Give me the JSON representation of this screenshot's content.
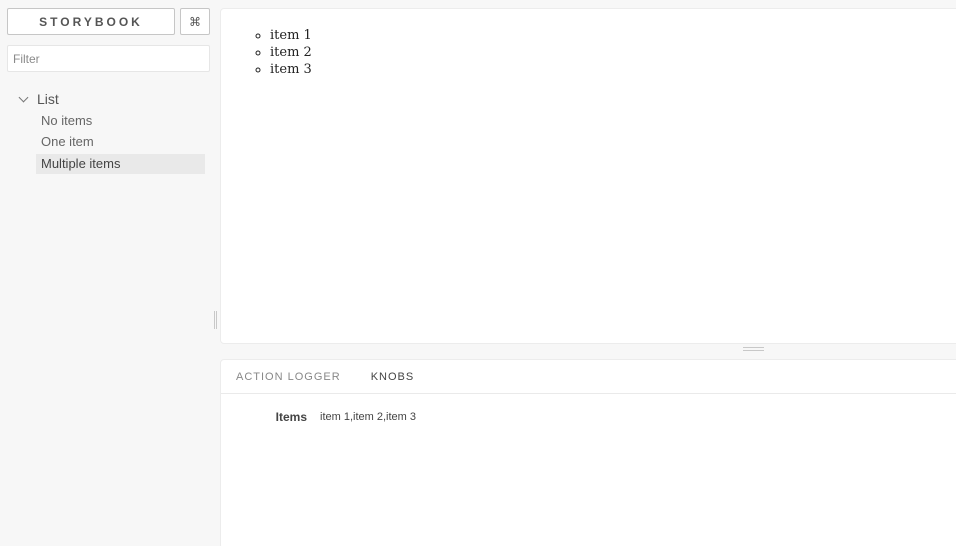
{
  "sidebar": {
    "brand": "STORYBOOK",
    "shortcut_button": "⌘",
    "filter": {
      "placeholder": "Filter",
      "value": ""
    },
    "kind": {
      "label": "List",
      "expanded": true
    },
    "stories": [
      {
        "label": "No items",
        "selected": false
      },
      {
        "label": "One item",
        "selected": false
      },
      {
        "label": "Multiple items",
        "selected": true
      }
    ]
  },
  "preview": {
    "items": [
      "item 1",
      "item 2",
      "item 3"
    ]
  },
  "addons": {
    "tabs": [
      {
        "label": "ACTION LOGGER",
        "active": false
      },
      {
        "label": "KNOBS",
        "active": true
      }
    ],
    "knobs": [
      {
        "label": "Items",
        "value": "item 1,item 2,item 3"
      }
    ]
  },
  "colors": {
    "background": "#f7f7f7",
    "panel": "#ffffff",
    "selected_story": "#e9e9e9"
  }
}
